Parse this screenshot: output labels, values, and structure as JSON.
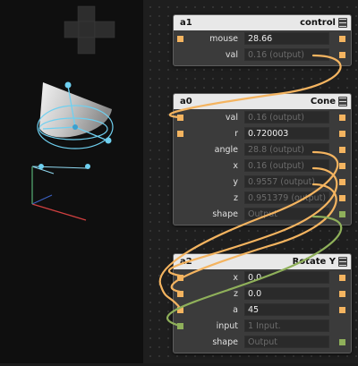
{
  "colors": {
    "number_port": "#f4b460",
    "geometry_port": "#8fb05a",
    "header": "#e8e8e8",
    "wire_number": "#f4b460",
    "wire_geometry": "#8fb05a"
  },
  "nodes": {
    "a1": {
      "id": "a1",
      "type": "control",
      "rows": [
        {
          "label": "mouse",
          "value": "28.66",
          "output": false
        },
        {
          "label": "val",
          "value": "0.16 (output)",
          "output": true
        }
      ]
    },
    "a0": {
      "id": "a0",
      "type": "Cone",
      "rows": [
        {
          "label": "val",
          "value": "0.16 (output)",
          "output": true
        },
        {
          "label": "r",
          "value": "0.720003",
          "output": false
        },
        {
          "label": "angle",
          "value": "28.8 (output)",
          "output": true
        },
        {
          "label": "x",
          "value": "0.16 (output)",
          "output": true
        },
        {
          "label": "y",
          "value": "0.9557 (output)",
          "output": true
        },
        {
          "label": "z",
          "value": "0.951379 (output)",
          "output": true
        },
        {
          "label": "shape",
          "value": "Output",
          "output": true
        }
      ]
    },
    "a2": {
      "id": "a2",
      "type": "Rotate Y",
      "rows": [
        {
          "label": "x",
          "value": "0.0",
          "output": false
        },
        {
          "label": "z",
          "value": "0.0",
          "output": false
        },
        {
          "label": "a",
          "value": "45",
          "output": false
        },
        {
          "label": "input",
          "value": "1 Input.",
          "output": true
        },
        {
          "label": "shape",
          "value": "Output",
          "output": true
        }
      ]
    }
  },
  "viewport": {
    "gizmo": "move-cross-icon",
    "object": "cone-3d"
  }
}
